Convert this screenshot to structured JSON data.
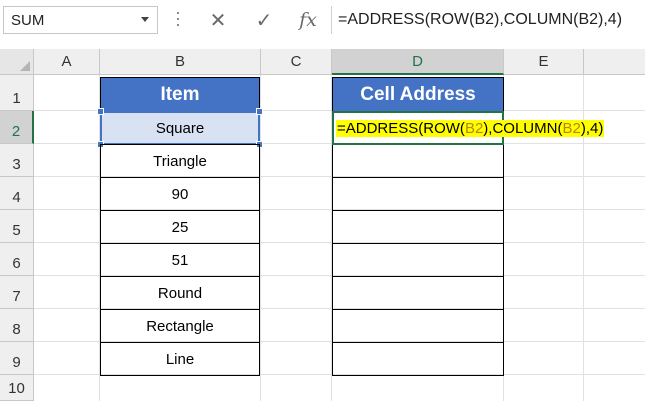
{
  "formula_bar": {
    "name_box": "SUM",
    "cancel_icon": "✕",
    "enter_icon": "✓",
    "function_icon": "fx",
    "formula": "=ADDRESS(ROW(B2),COLUMN(B2),4)"
  },
  "columns": [
    "A",
    "B",
    "C",
    "D",
    "E"
  ],
  "rows": [
    "1",
    "2",
    "3",
    "4",
    "5",
    "6",
    "7",
    "8",
    "9",
    "10"
  ],
  "headers": {
    "item": "Item",
    "cell_address": "Cell Address"
  },
  "items": [
    "Square",
    "Triangle",
    "90",
    "25",
    "51",
    "Round",
    "Rectangle",
    "Line"
  ],
  "editing_cell": {
    "ref": "D2",
    "parts": [
      "=ADDRESS(ROW(",
      "B2",
      "),COLUMN(",
      "B2",
      "),4)"
    ]
  },
  "colors": {
    "header_fill": "#4472c4",
    "selected_fill": "#d9e2f3",
    "edit_highlight": "#ffff00",
    "reference_color": "#b8860b",
    "active_accent": "#217346"
  }
}
